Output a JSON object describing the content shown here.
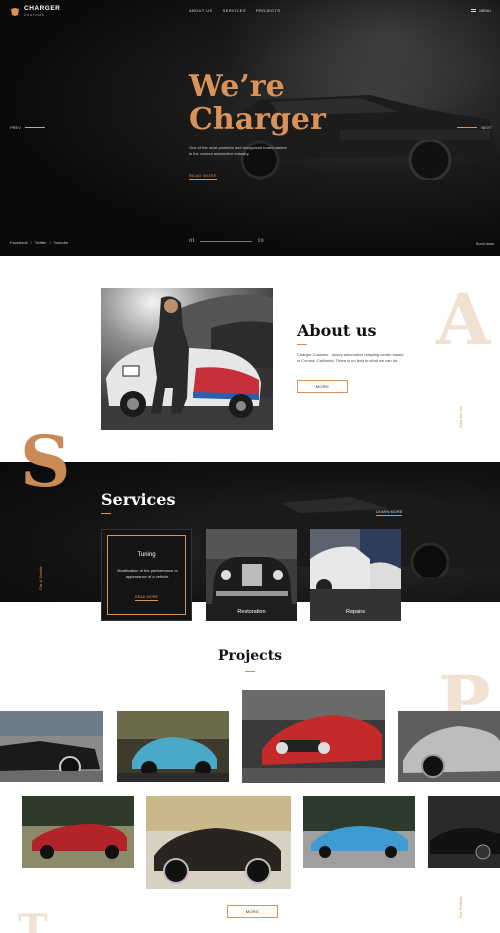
{
  "brand": {
    "name": "CHARGER",
    "sub": "CUSTOMS"
  },
  "nav": {
    "links": [
      "ABOUT US",
      "SERVICES",
      "PROJECTS"
    ],
    "menu": "MENU"
  },
  "hero": {
    "title_line1": "We’re",
    "title_line2": "Charger",
    "description": "One of the most powerful and recognized brand names in the custom automotive industry.",
    "read_more": "READ MORE",
    "prev": "PREV",
    "next": "NEXT",
    "social": [
      "Facebook",
      "/",
      "Twitter",
      "/",
      "Youtube"
    ],
    "page_current": "01",
    "page_total": "10",
    "scroll": "Scroll down"
  },
  "about": {
    "title": "About us",
    "text": "Charger Customs - luxury automotive restyling center based in Corona, California. There is no limit to what we can do.",
    "button": "MORE",
    "big_letter": "A",
    "side_label": "Who We are"
  },
  "services": {
    "title": "Services",
    "learn_more": "LEARN MORE",
    "big_letter": "S",
    "side_label": "Car & Details",
    "cards": [
      {
        "title": "Tuning",
        "desc": "Modification of the performance or appearance of a vehicle.",
        "more": "READ MORE"
      },
      {
        "title": "Restoration"
      },
      {
        "title": "Repairs"
      }
    ]
  },
  "projects": {
    "title": "Projects",
    "button": "MORE",
    "big_letter": "P",
    "bottom_letter": "T",
    "side_label": "Our Portfolio"
  },
  "colors": {
    "accent": "#d9935a",
    "dark": "#0b0b0b",
    "accent_light": "#f1e1d2"
  }
}
